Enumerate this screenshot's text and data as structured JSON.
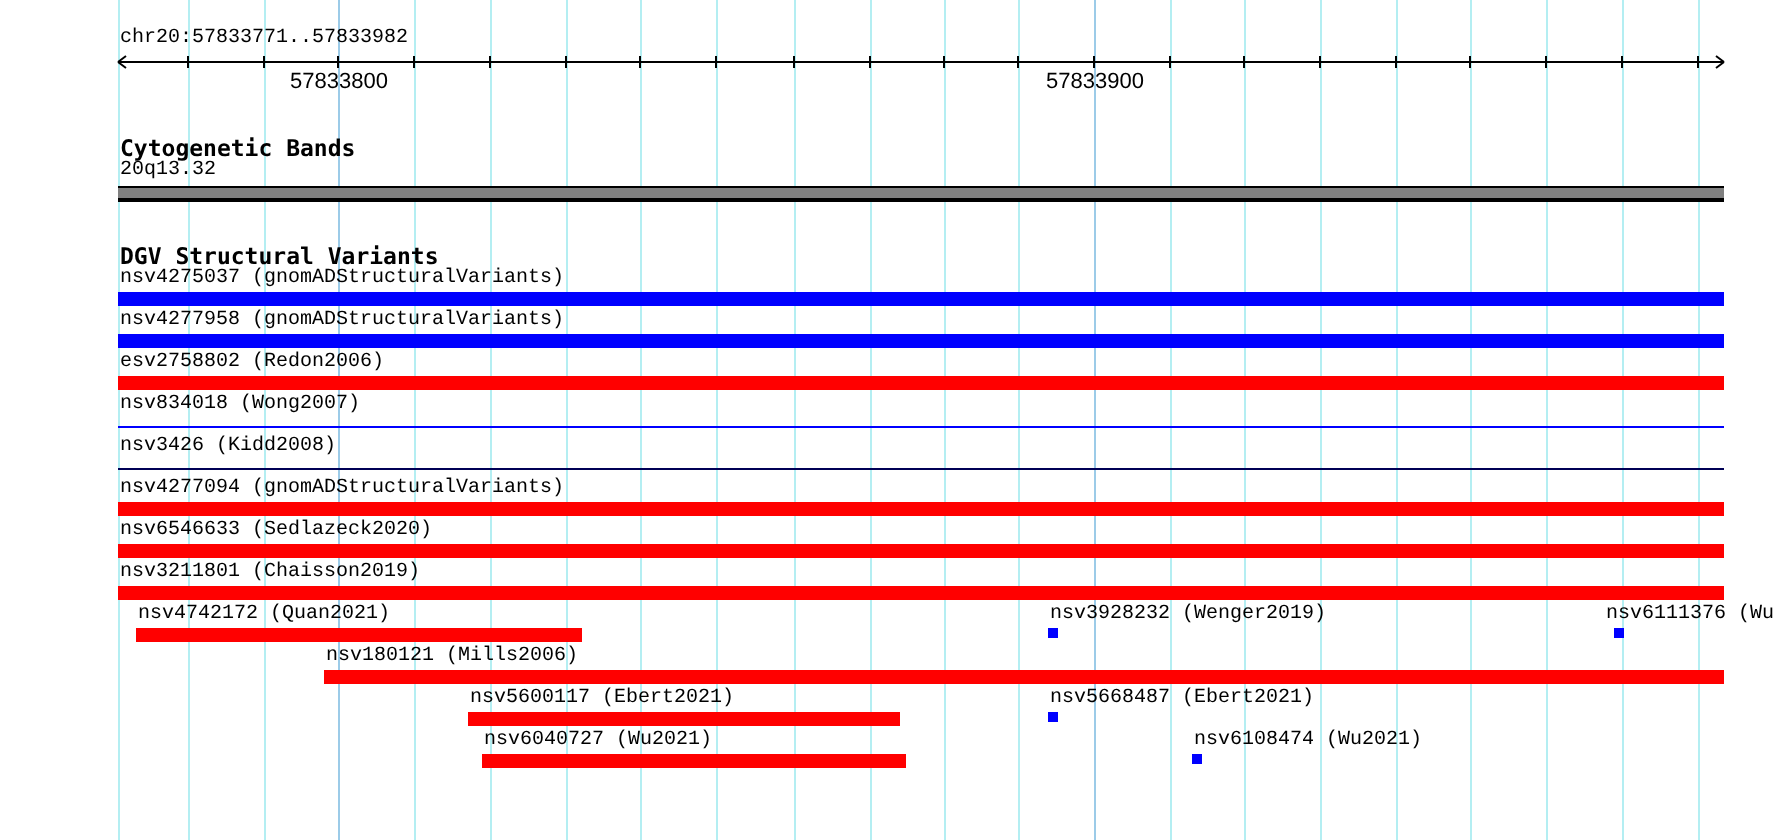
{
  "ruler": {
    "location": "chr20:57833771..57833982",
    "ticks": [
      {
        "label": "57833800"
      },
      {
        "label": "57833900"
      }
    ]
  },
  "cytoband_track": {
    "title": "Cytogenetic Bands",
    "band": "20q13.32"
  },
  "dgv_track": {
    "title": "DGV Structural Variants",
    "features": [
      {
        "label": "nsv4275037 (gnomADStructuralVariants)",
        "color": "#0000ff",
        "kind": "bar"
      },
      {
        "label": "nsv4277958 (gnomADStructuralVariants)",
        "color": "#0000ff",
        "kind": "bar"
      },
      {
        "label": "esv2758802 (Redon2006)",
        "color": "#ff0000",
        "kind": "bar"
      },
      {
        "label": "nsv834018 (Wong2007)",
        "color": "#0000ff",
        "kind": "line"
      },
      {
        "label": "nsv3426 (Kidd2008)",
        "color": "#000055",
        "kind": "line"
      },
      {
        "label": "nsv4277094 (gnomADStructuralVariants)",
        "color": "#ff0000",
        "kind": "bar"
      },
      {
        "label": "nsv6546633 (Sedlazeck2020)",
        "color": "#ff0000",
        "kind": "bar"
      },
      {
        "label": "nsv3211801 (Chaisson2019)",
        "color": "#ff0000",
        "kind": "bar"
      },
      {
        "label": "nsv4742172 (Quan2021)",
        "color": "#ff0000",
        "kind": "bar"
      },
      {
        "label": "nsv3928232 (Wenger2019)",
        "color": "#0000ff",
        "kind": "point"
      },
      {
        "label": "nsv6111376 (Wu",
        "color": "#0000ff",
        "kind": "point"
      },
      {
        "label": "nsv180121 (Mills2006)",
        "color": "#ff0000",
        "kind": "bar"
      },
      {
        "label": "nsv5600117 (Ebert2021)",
        "color": "#ff0000",
        "kind": "bar"
      },
      {
        "label": "nsv5668487 (Ebert2021)",
        "color": "#0000ff",
        "kind": "point"
      },
      {
        "label": "nsv6040727 (Wu2021)",
        "color": "#ff0000",
        "kind": "bar"
      },
      {
        "label": "nsv6108474 (Wu2021)",
        "color": "#0000ff",
        "kind": "point"
      }
    ]
  }
}
